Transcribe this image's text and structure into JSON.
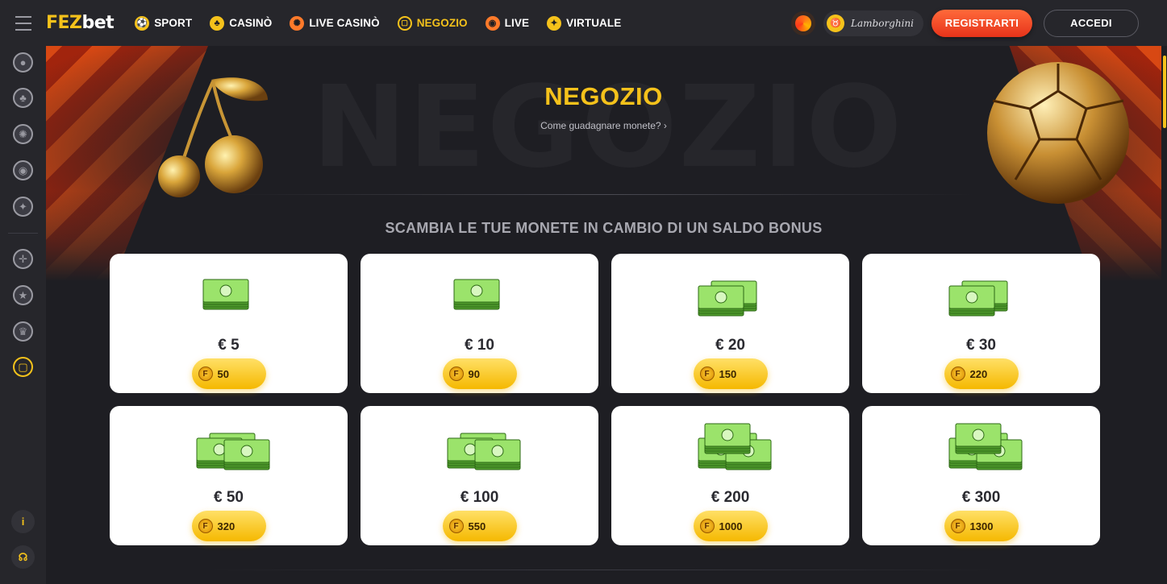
{
  "brand": {
    "logo_part1": "FEZ",
    "logo_part2": "bet"
  },
  "nav": [
    {
      "label": "SPORT",
      "icon": "soccer-ball-icon"
    },
    {
      "label": "CASINÒ",
      "icon": "spade-icon"
    },
    {
      "label": "LIVE CASINÒ",
      "icon": "roulette-icon"
    },
    {
      "label": "NEGOZIO",
      "icon": "shopping-bag-icon",
      "active": true
    },
    {
      "label": "LIVE",
      "icon": "live-signal-icon"
    },
    {
      "label": "VIRTUALE",
      "icon": "virtual-icon"
    }
  ],
  "header": {
    "lambo_label": "Lamborghini",
    "register_label": "REGISTRARTI",
    "login_label": "ACCEDI"
  },
  "sidebar": {
    "icons": [
      "soccer-ball-icon",
      "spade-icon",
      "roulette-icon",
      "live-signal-icon",
      "virtual-icon",
      "crosshair-icon",
      "star-icon",
      "trophy-icon",
      "shopping-bag-icon"
    ],
    "info_label": "i"
  },
  "hero": {
    "background_word": "NEGOZIO",
    "title": "NEGOZIO",
    "link": "Come guadagnare monete?"
  },
  "section_title": "SCAMBIA LE TUE MONETE IN CAMBIO DI UN SALDO BONUS",
  "coin_letter": "F",
  "products": [
    {
      "amount": "€ 5",
      "price": "50",
      "stacks": 1
    },
    {
      "amount": "€ 10",
      "price": "90",
      "stacks": 1
    },
    {
      "amount": "€ 20",
      "price": "150",
      "stacks": 2
    },
    {
      "amount": "€ 30",
      "price": "220",
      "stacks": 2
    },
    {
      "amount": "€ 50",
      "price": "320",
      "stacks": 3
    },
    {
      "amount": "€ 100",
      "price": "550",
      "stacks": 3
    },
    {
      "amount": "€ 200",
      "price": "1000",
      "stacks": 4
    },
    {
      "amount": "€ 300",
      "price": "1300",
      "stacks": 4
    }
  ],
  "colors": {
    "accent": "#f5c21b",
    "register": "#e6331a",
    "background": "#1e1e23",
    "money": "#7ed957"
  }
}
